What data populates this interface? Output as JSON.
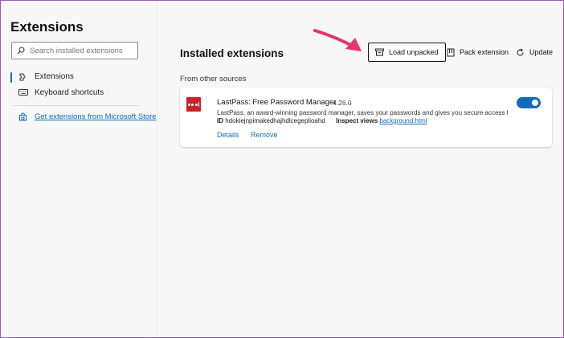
{
  "sidebar": {
    "title": "Extensions",
    "search_placeholder": "Search installed extensions",
    "items": [
      {
        "label": "Extensions",
        "icon": "puzzle-icon",
        "active": true
      },
      {
        "label": "Keyboard shortcuts",
        "icon": "keyboard-icon",
        "active": false
      }
    ],
    "store_link": {
      "label": "Get extensions from Microsoft Store",
      "icon": "store-icon"
    }
  },
  "main": {
    "title": "Installed extensions",
    "toolbar": {
      "load_unpacked": "Load unpacked",
      "pack_extension": "Pack extension",
      "update": "Update"
    },
    "section_label": "From other sources",
    "extension": {
      "name": "LastPass: Free Password Manager",
      "version": "4.26.0",
      "description": "LastPass, an award-winning password manager, saves your passwords and gives you secure access fro...",
      "id_label": "ID",
      "id_value": "hdokiejnpimakedhajhdlcegeplioahd",
      "inspect_label": "Inspect views",
      "inspect_link": "background.html",
      "details_label": "Details",
      "remove_label": "Remove",
      "enabled": true
    }
  },
  "colors": {
    "accent": "#0f6cbd",
    "annotation_arrow": "#e8336d",
    "lastpass_red": "#cc2128"
  }
}
